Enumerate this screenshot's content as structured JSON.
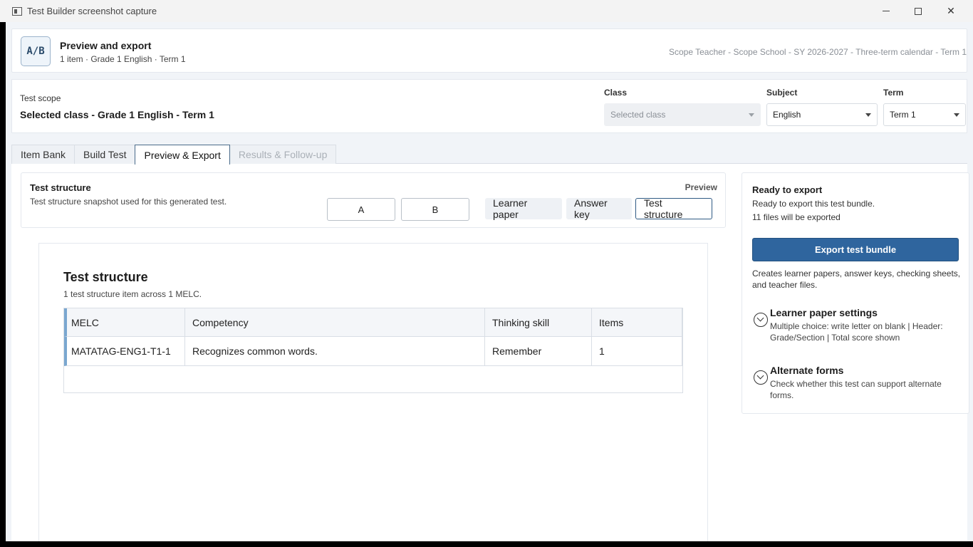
{
  "window": {
    "title": "Test Builder screenshot capture"
  },
  "header": {
    "logo_text": "A/B",
    "page_title": "Preview and export",
    "page_subtitle": "1 item · Grade 1 English · Term 1",
    "context": "Scope Teacher - Scope School - SY 2026-2027 - Three-term calendar - Term 1"
  },
  "scope": {
    "label": "Test scope",
    "value": "Selected class - Grade 1 English - Term 1",
    "class_label": "Class",
    "class_value": "Selected class",
    "subject_label": "Subject",
    "subject_value": "English",
    "term_label": "Term",
    "term_value": "Term 1"
  },
  "tabs": [
    {
      "label": "Item Bank"
    },
    {
      "label": "Build Test"
    },
    {
      "label": "Preview & Export"
    },
    {
      "label": "Results & Follow-up"
    }
  ],
  "preview_bar": {
    "title": "Test structure",
    "subtitle": "Test structure snapshot used for this generated test.",
    "label": "Preview",
    "forms": [
      "A",
      "B"
    ],
    "views": [
      "Learner paper",
      "Answer key",
      "Test structure"
    ]
  },
  "paper": {
    "title": "Test structure",
    "subtitle": "1 test structure item across 1 MELC.",
    "columns": [
      "MELC",
      "Competency",
      "Thinking skill",
      "Items"
    ],
    "rows": [
      [
        "MATATAG-ENG1-T1-1",
        "Recognizes common words.",
        "Remember",
        "1"
      ]
    ]
  },
  "export_panel": {
    "title": "Ready to export",
    "line1": "Ready to export this test bundle.",
    "line2": "11 files will be exported",
    "button": "Export test bundle",
    "note": "Creates learner papers, answer keys, checking sheets, and teacher files.",
    "sections": [
      {
        "title": "Learner paper settings",
        "text": "Multiple choice: write letter on blank | Header: Grade/Section | Total score shown"
      },
      {
        "title": "Alternate forms",
        "text": "Check whether this test can support alternate forms."
      }
    ]
  },
  "colors": {
    "accent": "#2f659e",
    "active_tab_border": "#4a6b8a",
    "table_marker": "#7aa7d0"
  }
}
